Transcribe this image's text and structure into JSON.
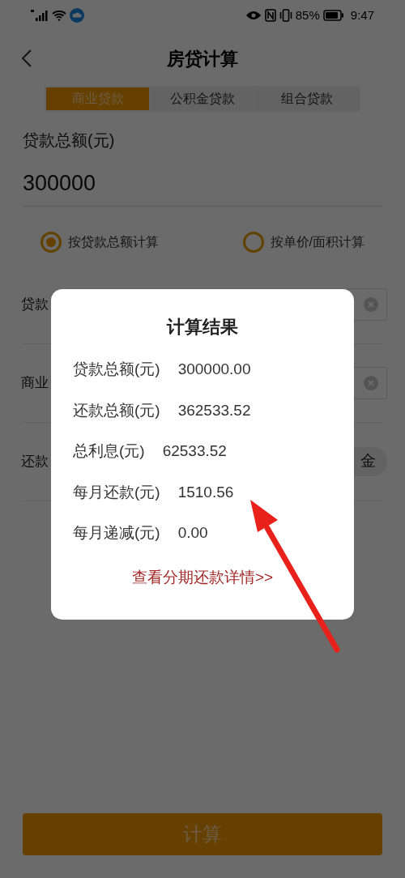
{
  "status_bar": {
    "battery": "85%",
    "time": "9:47"
  },
  "header": {
    "title": "房贷计算"
  },
  "tabs": [
    {
      "label": "商业贷款",
      "selected": true
    },
    {
      "label": "公积金贷款",
      "selected": false
    },
    {
      "label": "组合贷款",
      "selected": false
    }
  ],
  "loan_amount": {
    "label": "贷款总额(元)",
    "value": "300000"
  },
  "calc_modes": [
    {
      "label": "按贷款总额计算",
      "selected": true
    },
    {
      "label": "按单价/面积计算",
      "selected": false
    }
  ],
  "form_rows": [
    {
      "label": "贷款",
      "kind": "clear_field"
    },
    {
      "label": "商业",
      "kind": "clear_field"
    },
    {
      "label": "还款",
      "kind": "toggle",
      "option": "金"
    }
  ],
  "calculate_button": "计算",
  "result_dialog": {
    "title": "计算结果",
    "rows": [
      {
        "label": "贷款总额(元)",
        "value": "300000.00"
      },
      {
        "label": "还款总额(元)",
        "value": "362533.52"
      },
      {
        "label": "总利息(元)",
        "value": "62533.52"
      },
      {
        "label": "每月还款(元)",
        "value": "1510.56"
      },
      {
        "label": "每月递减(元)",
        "value": "0.00"
      }
    ],
    "link": "查看分期还款详情>>"
  }
}
